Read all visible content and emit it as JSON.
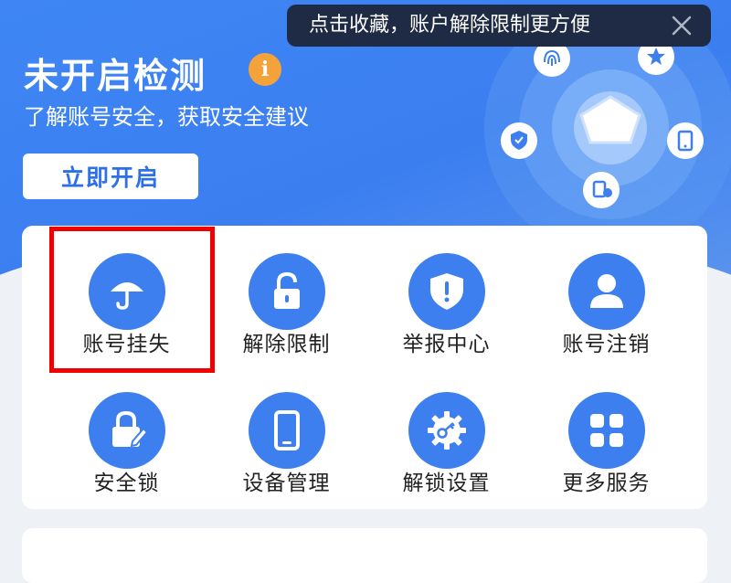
{
  "hero": {
    "title": "未开启检测",
    "info_badge": "i",
    "subtitle": "了解账号安全，获取安全建议",
    "enable_button": "立即开启",
    "accent_color": "#3f86f4",
    "radar_icons": [
      "fingerprint-icon",
      "star-icon",
      "shield-check-icon",
      "tablet-icon",
      "id-lock-icon",
      "pentagon-icon"
    ]
  },
  "toast": {
    "text": "点击收藏，账户解除限制更方便",
    "close_icon": "close-icon"
  },
  "services": {
    "items": [
      {
        "label": "账号挂失",
        "icon": "umbrella-icon"
      },
      {
        "label": "解除限制",
        "icon": "unlock-icon"
      },
      {
        "label": "举报中心",
        "icon": "shield-alert-icon"
      },
      {
        "label": "账号注销",
        "icon": "user-icon"
      },
      {
        "label": "安全锁",
        "icon": "lock-edit-icon"
      },
      {
        "label": "设备管理",
        "icon": "phone-icon"
      },
      {
        "label": "解锁设置",
        "icon": "gear-key-icon"
      },
      {
        "label": "更多服务",
        "icon": "grid-icon"
      }
    ],
    "icon_color": "#3d7fee",
    "highlight_color": "#f00000"
  }
}
